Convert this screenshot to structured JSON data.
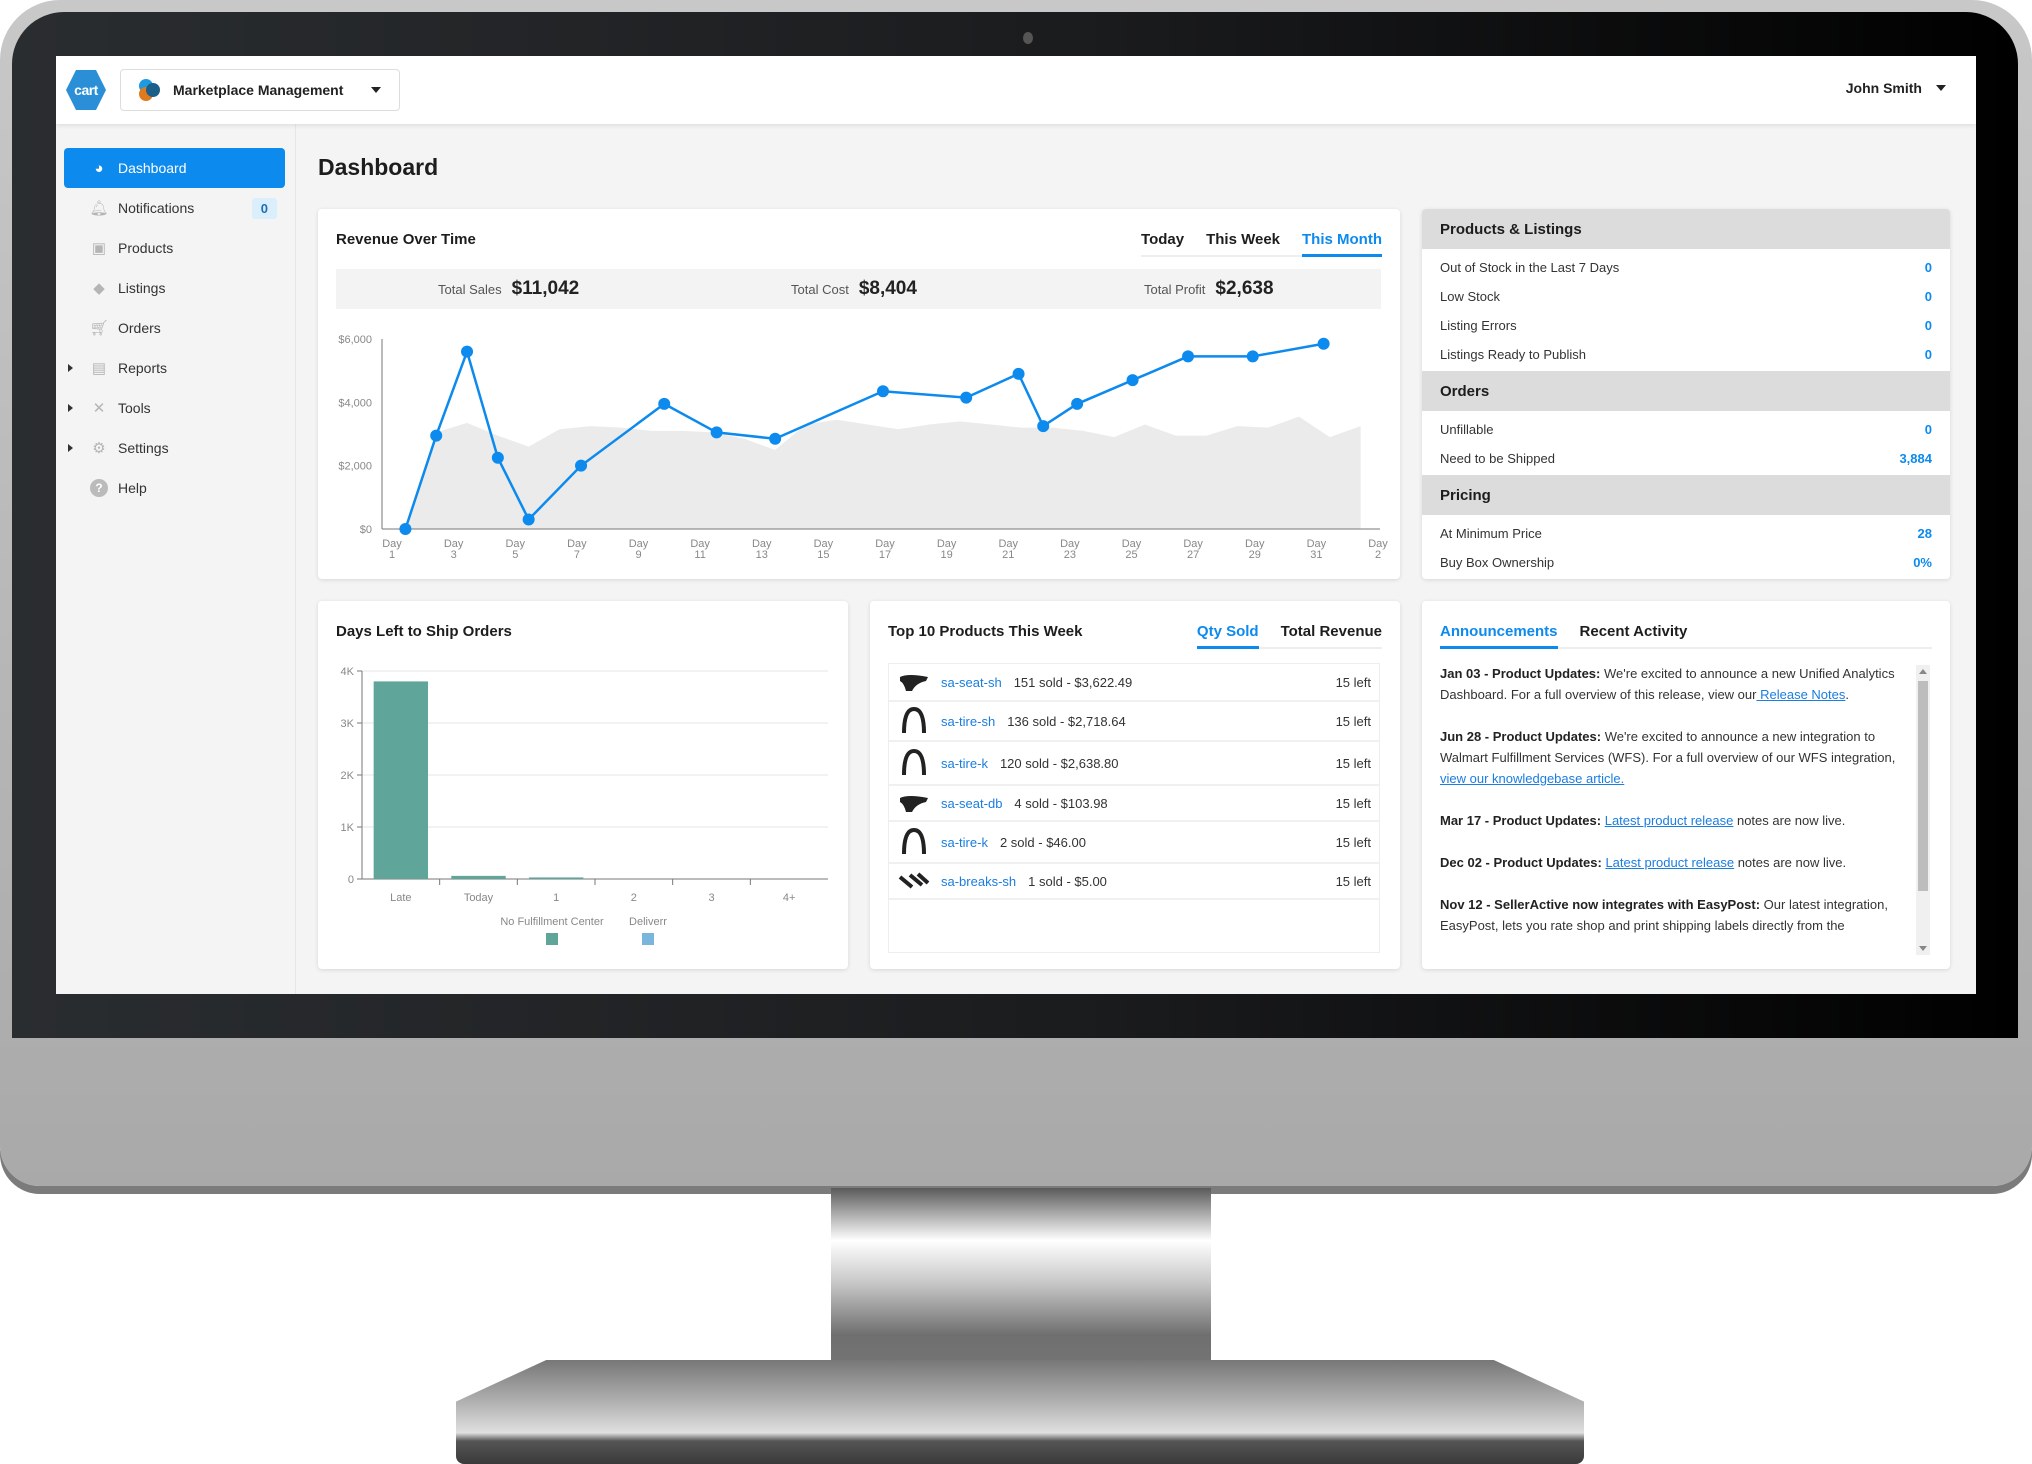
{
  "header": {
    "logo_text": "cart",
    "app_switcher_label": "Marketplace Management",
    "user_name": "John Smith"
  },
  "sidebar": {
    "items": [
      {
        "label": "Dashboard",
        "icon": "dashboard-icon",
        "active": true,
        "expandable": false
      },
      {
        "label": "Notifications",
        "icon": "bell-icon",
        "badge": "0",
        "expandable": false
      },
      {
        "label": "Products",
        "icon": "box-icon",
        "expandable": false
      },
      {
        "label": "Listings",
        "icon": "tag-icon",
        "expandable": false
      },
      {
        "label": "Orders",
        "icon": "cart-icon",
        "expandable": false
      },
      {
        "label": "Reports",
        "icon": "report-icon",
        "expandable": true
      },
      {
        "label": "Tools",
        "icon": "tools-icon",
        "expandable": true
      },
      {
        "label": "Settings",
        "icon": "gear-icon",
        "expandable": true
      },
      {
        "label": "Help",
        "icon": "help-icon",
        "expandable": false
      }
    ]
  },
  "page": {
    "title": "Dashboard"
  },
  "revenue": {
    "title": "Revenue Over Time",
    "tabs": [
      {
        "label": "Today",
        "active": false
      },
      {
        "label": "This Week",
        "active": false
      },
      {
        "label": "This Month",
        "active": true
      }
    ],
    "summary": {
      "sales_label": "Total Sales",
      "sales_value": "$11,042",
      "cost_label": "Total Cost",
      "cost_value": "$8,404",
      "profit_label": "Total Profit",
      "profit_value": "$2,638"
    }
  },
  "colors": {
    "accent": "#0d8aed",
    "bar_primary": "#5fa59a",
    "bar_secondary": "#7ab6dc",
    "area": "#ebebeb"
  },
  "chart_data": [
    {
      "type": "line",
      "title": "Revenue Over Time",
      "xlabel": "",
      "ylabel": "",
      "ylim": [
        0,
        6000
      ],
      "yticks": [
        0,
        2000,
        4000,
        6000
      ],
      "ytick_labels": [
        "$0",
        "$2,000",
        "$4,000",
        "$6,000"
      ],
      "xlim": [
        1,
        33
      ],
      "xtick_positions": [
        1,
        3,
        5,
        7,
        9,
        11,
        13,
        15,
        17,
        19,
        21,
        23,
        25,
        27,
        29,
        31,
        33
      ],
      "xtick_labels": [
        "Day 1",
        "Day 3",
        "Day 5",
        "Day 7",
        "Day 9",
        "Day 11",
        "Day 13",
        "Day 15",
        "Day 17",
        "Day 19",
        "Day 21",
        "Day 23",
        "Day 25",
        "Day 27",
        "Day 29",
        "Day 31",
        "Day 2"
      ],
      "series": [
        {
          "name": "Revenue",
          "x": [
            1.5,
            2.5,
            3.5,
            4.5,
            5.5,
            7.2,
            9.9,
            11.6,
            13.5,
            17.0,
            19.7,
            21.4,
            22.2,
            23.3,
            25.1,
            26.9,
            29.0,
            31.3
          ],
          "values": [
            0,
            2950,
            5600,
            2250,
            300,
            2000,
            3950,
            3050,
            2850,
            4350,
            4150,
            4900,
            3250,
            3950,
            4700,
            5450,
            5450,
            5850
          ]
        },
        {
          "name": "Comparison (area)",
          "x": [
            1.5,
            2.5,
            3.5,
            4.5,
            5.5,
            6.5,
            7.5,
            8.5,
            9.5,
            10.5,
            11.5,
            12.5,
            13.5,
            14.5,
            15.5,
            16.5,
            17.5,
            18.5,
            19.5,
            20.5,
            21.5,
            22.5,
            23.5,
            24.5,
            25.5,
            26.5,
            27.5,
            28.5,
            29.5,
            30.5,
            31.5,
            32.5
          ],
          "values": [
            0,
            3050,
            3350,
            2950,
            2600,
            3150,
            3250,
            3200,
            3100,
            3100,
            3050,
            2850,
            2500,
            3300,
            3450,
            3300,
            3150,
            3300,
            3400,
            3300,
            3200,
            3200,
            3100,
            2900,
            3300,
            2950,
            2950,
            3250,
            3200,
            3550,
            2900,
            3250
          ]
        }
      ],
      "grid": false,
      "legend": "none"
    },
    {
      "type": "bar",
      "title": "Days Left to Ship Orders",
      "categories": [
        "Late",
        "Today",
        "1",
        "2",
        "3",
        "4+"
      ],
      "series": [
        {
          "name": "No Fulfillment Center",
          "values": [
            3800,
            60,
            30,
            0,
            0,
            0
          ]
        },
        {
          "name": "Deliverr",
          "values": [
            0,
            0,
            0,
            0,
            0,
            0
          ]
        }
      ],
      "ylim": [
        0,
        4000
      ],
      "yticks": [
        0,
        1000,
        2000,
        3000,
        4000
      ],
      "ytick_labels": [
        "0",
        "1K",
        "2K",
        "3K",
        "4K"
      ],
      "grid": true,
      "legend": "bottom-center"
    }
  ],
  "stats": {
    "sections": [
      {
        "title": "Products & Listings",
        "rows": [
          {
            "label": "Out of Stock in the Last 7 Days",
            "value": "0"
          },
          {
            "label": "Low Stock",
            "value": "0"
          },
          {
            "label": "Listing Errors",
            "value": "0"
          },
          {
            "label": "Listings Ready to Publish",
            "value": "0"
          }
        ]
      },
      {
        "title": "Orders",
        "rows": [
          {
            "label": "Unfillable",
            "value": "0"
          },
          {
            "label": "Need to be Shipped",
            "value": "3,884"
          }
        ]
      },
      {
        "title": "Pricing",
        "rows": [
          {
            "label": "At Minimum Price",
            "value": "28"
          },
          {
            "label": "Buy Box Ownership",
            "value": "0%"
          }
        ]
      }
    ]
  },
  "days_left": {
    "title": "Days Left to Ship Orders"
  },
  "top_products": {
    "title": "Top 10 Products This Week",
    "tabs": [
      {
        "label": "Qty Sold",
        "active": true
      },
      {
        "label": "Total Revenue",
        "active": false
      }
    ],
    "rows": [
      {
        "sku": "sa-seat-sh",
        "summary": "151 sold - $3,622.49",
        "stock": "15 left",
        "thumb": "seat-icon"
      },
      {
        "sku": "sa-tire-sh",
        "summary": "136 sold - $2,718.64",
        "stock": "15 left",
        "thumb": "tire-icon"
      },
      {
        "sku": "sa-tire-k",
        "summary": "120 sold - $2,638.80",
        "stock": "15 left",
        "thumb": "tire-icon"
      },
      {
        "sku": "sa-seat-db",
        "summary": "4 sold - $103.98",
        "stock": "15 left",
        "thumb": "seat-icon"
      },
      {
        "sku": "sa-tire-k",
        "summary": "2 sold - $46.00",
        "stock": "15 left",
        "thumb": "tire-icon"
      },
      {
        "sku": "sa-breaks-sh",
        "summary": "1 sold - $5.00",
        "stock": "15 left",
        "thumb": "brake-icon"
      }
    ]
  },
  "announcements": {
    "tabs": [
      {
        "label": "Announcements",
        "active": true
      },
      {
        "label": "Recent Activity",
        "active": false
      }
    ],
    "items": [
      {
        "heading": "Jan 03 - Product Updates:",
        "text_before": " We're excited to announce a new Unified Analytics Dashboard. For a full overview of this release, view our",
        "link": " Release Notes",
        "text_after": "."
      },
      {
        "heading": "Jun 28 - Product Updates:",
        "text_before": " We're excited to announce a new integration to Walmart Fulfillment Services (WFS). For a full overview of our WFS integration, ",
        "link": "view our knowledgebase article. ",
        "text_after": ""
      },
      {
        "heading": "Mar 17 - Product Updates:",
        "text_before": " ",
        "link": "Latest product release",
        "text_after": " notes are now live."
      },
      {
        "heading": "Dec 02 - Product Updates:",
        "text_before": " ",
        "link": "Latest product release",
        "text_after": " notes are now live."
      },
      {
        "heading": "Nov 12 - SellerActive now integrates with EasyPost:",
        "text_before": " Our latest integration, EasyPost, lets you rate shop and print shipping labels directly from the",
        "link": "",
        "text_after": ""
      }
    ]
  }
}
